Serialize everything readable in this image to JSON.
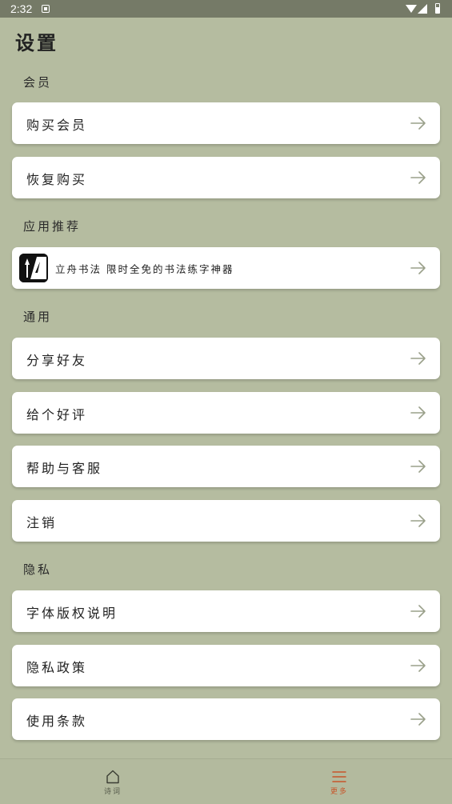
{
  "status_bar": {
    "time": "2:32"
  },
  "page": {
    "title": "设置"
  },
  "sections": {
    "membership": {
      "header": "会员",
      "items": [
        "购买会员",
        "恢复购买"
      ]
    },
    "recommend": {
      "header": "应用推荐",
      "app_text": "立舟书法 限时全免的书法练字神器"
    },
    "general": {
      "header": "通用",
      "items": [
        "分享好友",
        "给个好评",
        "帮助与客服",
        "注销"
      ]
    },
    "privacy": {
      "header": "隐私",
      "items": [
        "字体版权说明",
        "隐私政策",
        "使用条款"
      ]
    }
  },
  "bottom_nav": {
    "items": [
      {
        "label": "诗词",
        "icon": "home-icon",
        "active": false
      },
      {
        "label": "更多",
        "icon": "menu-icon",
        "active": true
      }
    ]
  },
  "colors": {
    "background": "#b5bca0",
    "card": "#ffffff",
    "arrow": "#9aa08a",
    "accent_active": "#c8552a",
    "status_bar": "#757a67"
  }
}
